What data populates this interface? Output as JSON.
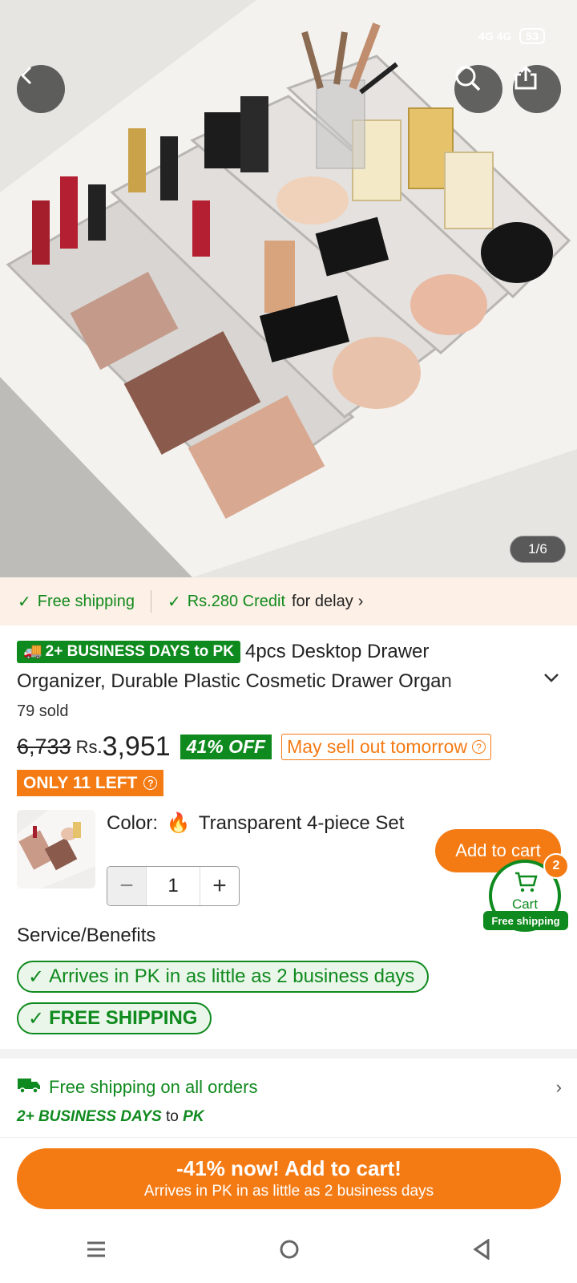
{
  "status_bar": {
    "time": "",
    "network": "4G 4G",
    "battery": "53"
  },
  "hero": {
    "image_counter": "1/6"
  },
  "shipping_strip": {
    "free_shipping": "Free shipping",
    "credit": "Rs.280 Credit",
    "credit_suffix": "for delay"
  },
  "product": {
    "business_badge": "2+ BUSINESS DAYS to PK",
    "title_line1": "4pcs Desktop Drawer",
    "title_line2": "Organizer, Durable Plastic Cosmetic Drawer Organ",
    "sold": "79 sold",
    "original_price": "6,733",
    "currency": "Rs.",
    "price": "3,951",
    "discount": "41% OFF",
    "sellout_label": "May sell out tomorrow",
    "stock_label": "ONLY 11 LEFT"
  },
  "variant": {
    "label": "Color:",
    "value": "Transparent 4-piece Set",
    "quantity": "1"
  },
  "actions": {
    "add_to_cart": "Add to cart",
    "cart_label": "Cart",
    "cart_count": "2",
    "cart_free_shipping": "Free shipping"
  },
  "service": {
    "title": "Service/Benefits",
    "benefits": [
      "Arrives in PK in as little as 2 business days",
      "FREE SHIPPING"
    ]
  },
  "shipping_info": {
    "free_all": "Free shipping on all orders",
    "biz_days": "2+ BUSINESS DAYS",
    "to": "to",
    "dest": "PK"
  },
  "cta": {
    "main": "-41% now! Add to cart!",
    "sub": "Arrives in PK in as little as 2 business days"
  },
  "colors": {
    "accent_orange": "#f47b14",
    "accent_green": "#0f8a1e",
    "strip_bg": "#fdf0e6"
  }
}
